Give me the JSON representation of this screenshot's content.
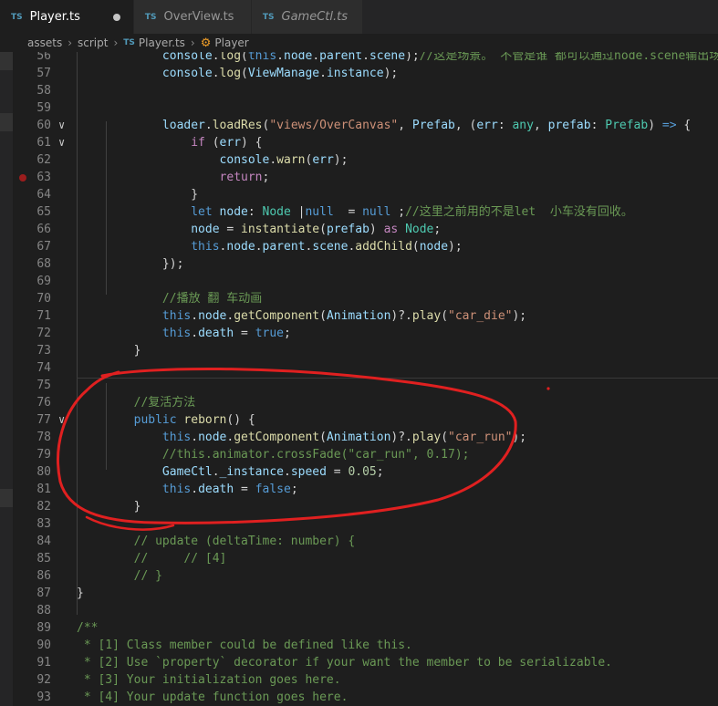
{
  "tabs": [
    {
      "lang": "TS",
      "label": "Player.ts",
      "active": true,
      "modified": true
    },
    {
      "lang": "TS",
      "label": "OverView.ts",
      "active": false,
      "modified": false
    },
    {
      "lang": "TS",
      "label": "GameCtl.ts",
      "active": false,
      "modified": false,
      "italic": true
    }
  ],
  "breadcrumb": {
    "parts": [
      "assets",
      "script"
    ],
    "file_lang": "TS",
    "file": "Player.ts",
    "symbol": "Player"
  },
  "lines": [
    {
      "n": "56",
      "tokens": [
        [
          "pl",
          "            "
        ],
        [
          "var",
          "console"
        ],
        [
          "pl",
          "."
        ],
        [
          "fn",
          "log"
        ],
        [
          "pl",
          "("
        ],
        [
          "kw",
          "this"
        ],
        [
          "pl",
          "."
        ],
        [
          "var",
          "node"
        ],
        [
          "pl",
          "."
        ],
        [
          "var",
          "parent"
        ],
        [
          "pl",
          "."
        ],
        [
          "var",
          "scene"
        ],
        [
          "pl",
          ");"
        ],
        [
          "cm",
          "//这是场景。 不管是谁 都可以通过node.scene输出场景"
        ]
      ]
    },
    {
      "n": "57",
      "tokens": [
        [
          "pl",
          "            "
        ],
        [
          "var",
          "console"
        ],
        [
          "pl",
          "."
        ],
        [
          "fn",
          "log"
        ],
        [
          "pl",
          "("
        ],
        [
          "var",
          "ViewManage"
        ],
        [
          "pl",
          "."
        ],
        [
          "var",
          "instance"
        ],
        [
          "pl",
          ");"
        ]
      ]
    },
    {
      "n": "58",
      "tokens": []
    },
    {
      "n": "59",
      "tokens": []
    },
    {
      "n": "60",
      "fold": "∨",
      "tokens": [
        [
          "pl",
          "            "
        ],
        [
          "var",
          "loader"
        ],
        [
          "pl",
          "."
        ],
        [
          "fn",
          "loadRes"
        ],
        [
          "pl",
          "("
        ],
        [
          "str",
          "\"views/OverCanvas\""
        ],
        [
          "pl",
          ", "
        ],
        [
          "var",
          "Prefab"
        ],
        [
          "pl",
          ", ("
        ],
        [
          "var",
          "err"
        ],
        [
          "pl",
          ": "
        ],
        [
          "typ",
          "any"
        ],
        [
          "pl",
          ", "
        ],
        [
          "var",
          "prefab"
        ],
        [
          "pl",
          ": "
        ],
        [
          "typ",
          "Prefab"
        ],
        [
          "pl",
          ") "
        ],
        [
          "kw",
          "=>"
        ],
        [
          "pl",
          " {"
        ]
      ]
    },
    {
      "n": "61",
      "fold": "∨",
      "tokens": [
        [
          "pl",
          "                "
        ],
        [
          "kw2",
          "if"
        ],
        [
          "pl",
          " ("
        ],
        [
          "var",
          "err"
        ],
        [
          "pl",
          ") {"
        ]
      ]
    },
    {
      "n": "62",
      "tokens": [
        [
          "pl",
          "                    "
        ],
        [
          "var",
          "console"
        ],
        [
          "pl",
          "."
        ],
        [
          "fn",
          "warn"
        ],
        [
          "pl",
          "("
        ],
        [
          "var",
          "err"
        ],
        [
          "pl",
          ");"
        ]
      ]
    },
    {
      "n": "63",
      "bp": true,
      "tokens": [
        [
          "pl",
          "                    "
        ],
        [
          "kw2",
          "return"
        ],
        [
          "pl",
          ";"
        ]
      ]
    },
    {
      "n": "64",
      "tokens": [
        [
          "pl",
          "                }"
        ]
      ]
    },
    {
      "n": "65",
      "tokens": [
        [
          "pl",
          "                "
        ],
        [
          "kw",
          "let"
        ],
        [
          "pl",
          " "
        ],
        [
          "var",
          "node"
        ],
        [
          "pl",
          ": "
        ],
        [
          "typ",
          "Node"
        ],
        [
          "pl",
          " |"
        ],
        [
          "kw",
          "null"
        ],
        [
          "pl",
          "  = "
        ],
        [
          "kw",
          "null"
        ],
        [
          "pl",
          " ;"
        ],
        [
          "cm",
          "//这里之前用的不是let  小车没有回收。"
        ]
      ]
    },
    {
      "n": "66",
      "tokens": [
        [
          "pl",
          "                "
        ],
        [
          "var",
          "node"
        ],
        [
          "pl",
          " = "
        ],
        [
          "fn",
          "instantiate"
        ],
        [
          "pl",
          "("
        ],
        [
          "var",
          "prefab"
        ],
        [
          "pl",
          ") "
        ],
        [
          "kw2",
          "as"
        ],
        [
          "pl",
          " "
        ],
        [
          "typ",
          "Node"
        ],
        [
          "pl",
          ";"
        ]
      ]
    },
    {
      "n": "67",
      "tokens": [
        [
          "pl",
          "                "
        ],
        [
          "kw",
          "this"
        ],
        [
          "pl",
          "."
        ],
        [
          "var",
          "node"
        ],
        [
          "pl",
          "."
        ],
        [
          "var",
          "parent"
        ],
        [
          "pl",
          "."
        ],
        [
          "var",
          "scene"
        ],
        [
          "pl",
          "."
        ],
        [
          "fn",
          "addChild"
        ],
        [
          "pl",
          "("
        ],
        [
          "var",
          "node"
        ],
        [
          "pl",
          ");"
        ]
      ]
    },
    {
      "n": "68",
      "tokens": [
        [
          "pl",
          "            });"
        ]
      ]
    },
    {
      "n": "69",
      "tokens": []
    },
    {
      "n": "70",
      "tokens": [
        [
          "pl",
          "            "
        ],
        [
          "cm",
          "//播放 翻 车动画"
        ]
      ]
    },
    {
      "n": "71",
      "tokens": [
        [
          "pl",
          "            "
        ],
        [
          "kw",
          "this"
        ],
        [
          "pl",
          "."
        ],
        [
          "var",
          "node"
        ],
        [
          "pl",
          "."
        ],
        [
          "fn",
          "getComponent"
        ],
        [
          "pl",
          "("
        ],
        [
          "var",
          "Animation"
        ],
        [
          "pl",
          ")?."
        ],
        [
          "fn",
          "play"
        ],
        [
          "pl",
          "("
        ],
        [
          "str",
          "\"car_die\""
        ],
        [
          "pl",
          ");"
        ]
      ]
    },
    {
      "n": "72",
      "tokens": [
        [
          "pl",
          "            "
        ],
        [
          "kw",
          "this"
        ],
        [
          "pl",
          "."
        ],
        [
          "var",
          "death"
        ],
        [
          "pl",
          " = "
        ],
        [
          "kw",
          "true"
        ],
        [
          "pl",
          ";"
        ]
      ]
    },
    {
      "n": "73",
      "tokens": [
        [
          "pl",
          "        }"
        ]
      ]
    },
    {
      "n": "74",
      "tokens": []
    },
    {
      "n": "75",
      "tokens": []
    },
    {
      "n": "76",
      "tokens": [
        [
          "pl",
          "        "
        ],
        [
          "cm",
          "//复活方法"
        ]
      ]
    },
    {
      "n": "77",
      "fold": "∨",
      "tokens": [
        [
          "pl",
          "        "
        ],
        [
          "kw",
          "public"
        ],
        [
          "pl",
          " "
        ],
        [
          "fn",
          "reborn"
        ],
        [
          "pl",
          "() {"
        ]
      ]
    },
    {
      "n": "78",
      "tokens": [
        [
          "pl",
          "            "
        ],
        [
          "kw",
          "this"
        ],
        [
          "pl",
          "."
        ],
        [
          "var",
          "node"
        ],
        [
          "pl",
          "."
        ],
        [
          "fn",
          "getComponent"
        ],
        [
          "pl",
          "("
        ],
        [
          "var",
          "Animation"
        ],
        [
          "pl",
          ")?."
        ],
        [
          "fn",
          "play"
        ],
        [
          "pl",
          "("
        ],
        [
          "str",
          "\"car_run\""
        ],
        [
          "pl",
          ");"
        ]
      ]
    },
    {
      "n": "79",
      "tokens": [
        [
          "pl",
          "            "
        ],
        [
          "cm",
          "//this.animator.crossFade(\"car_run\", 0.17);"
        ]
      ]
    },
    {
      "n": "80",
      "tokens": [
        [
          "pl",
          "            "
        ],
        [
          "var",
          "GameCtl"
        ],
        [
          "pl",
          "."
        ],
        [
          "var",
          "_instance"
        ],
        [
          "pl",
          "."
        ],
        [
          "var",
          "speed"
        ],
        [
          "pl",
          " = "
        ],
        [
          "num",
          "0.05"
        ],
        [
          "pl",
          ";"
        ]
      ]
    },
    {
      "n": "81",
      "tokens": [
        [
          "pl",
          "            "
        ],
        [
          "kw",
          "this"
        ],
        [
          "pl",
          "."
        ],
        [
          "var",
          "death"
        ],
        [
          "pl",
          " = "
        ],
        [
          "kw",
          "false"
        ],
        [
          "pl",
          ";"
        ]
      ]
    },
    {
      "n": "82",
      "tokens": [
        [
          "pl",
          "        }"
        ]
      ]
    },
    {
      "n": "83",
      "tokens": []
    },
    {
      "n": "84",
      "tokens": [
        [
          "pl",
          "        "
        ],
        [
          "cm",
          "// update (deltaTime: number) {"
        ]
      ]
    },
    {
      "n": "85",
      "tokens": [
        [
          "pl",
          "        "
        ],
        [
          "cm",
          "//     // [4]"
        ]
      ]
    },
    {
      "n": "86",
      "tokens": [
        [
          "pl",
          "        "
        ],
        [
          "cm",
          "// }"
        ]
      ]
    },
    {
      "n": "87",
      "tokens": [
        [
          "pl",
          "}"
        ]
      ]
    },
    {
      "n": "88",
      "tokens": []
    },
    {
      "n": "89",
      "tokens": [
        [
          "cm",
          "/**"
        ]
      ]
    },
    {
      "n": "90",
      "tokens": [
        [
          "cm",
          " * [1] Class member could be defined like this."
        ]
      ]
    },
    {
      "n": "91",
      "tokens": [
        [
          "cm",
          " * [2] Use `property` decorator if your want the member to be serializable."
        ]
      ]
    },
    {
      "n": "92",
      "tokens": [
        [
          "cm",
          " * [3] Your initialization goes here."
        ]
      ]
    },
    {
      "n": "93",
      "tokens": [
        [
          "cm",
          " * [4] Your update function goes here."
        ]
      ]
    }
  ]
}
